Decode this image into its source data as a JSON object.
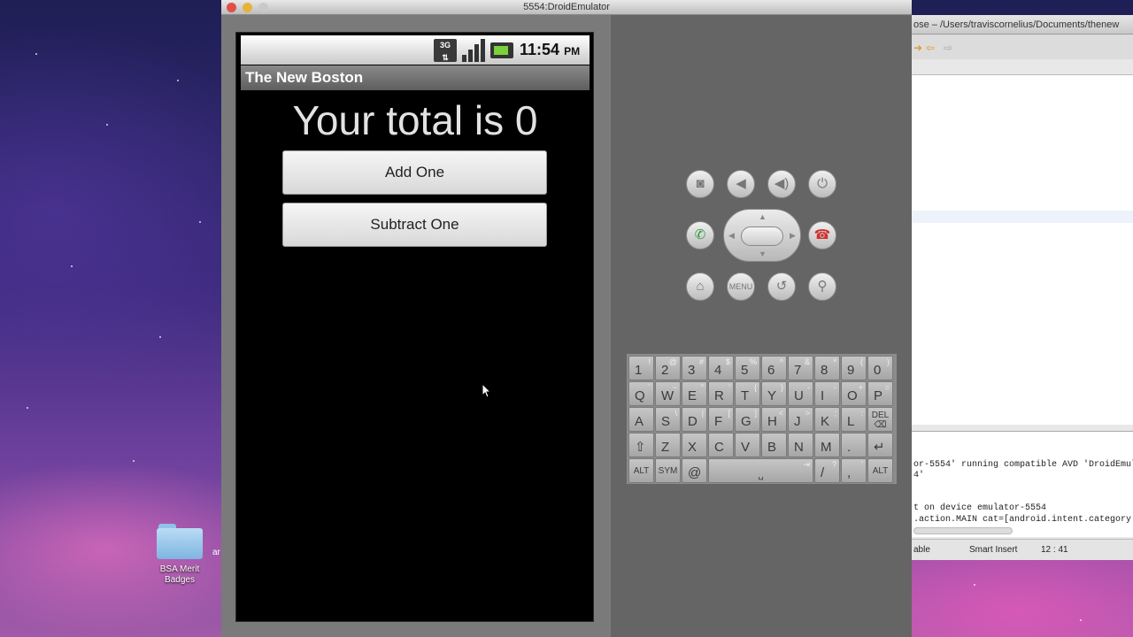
{
  "desktop": {
    "folder_label": "BSA Merit\nBadges",
    "fragment": "ar"
  },
  "eclipse": {
    "title": "ose – /Users/traviscornelius/Documents/thenew",
    "console_lines": [
      "or-5554' running compatible AVD 'DroidEmulat",
      "4'",
      "t on device emulator-5554",
      ".action.MAIN cat=[android.intent.category.LA"
    ],
    "status": {
      "writable": "able",
      "insert_mode": "Smart Insert",
      "position": "12 : 41"
    }
  },
  "emulator": {
    "window_title": "5554:DroidEmulator",
    "statusbar": {
      "network": "3G",
      "time": "11:54",
      "ampm": "PM"
    },
    "app_title": "The New Boston",
    "total_text": "Your total is 0",
    "buttons": {
      "add": "Add One",
      "subtract": "Subtract One"
    },
    "controls": {
      "menu": "MENU"
    },
    "keyboard": {
      "row1": [
        {
          "m": "1",
          "s": "!"
        },
        {
          "m": "2",
          "s": "@"
        },
        {
          "m": "3",
          "s": "#"
        },
        {
          "m": "4",
          "s": "$"
        },
        {
          "m": "5",
          "s": "%"
        },
        {
          "m": "6",
          "s": "^"
        },
        {
          "m": "7",
          "s": "&"
        },
        {
          "m": "8",
          "s": "*"
        },
        {
          "m": "9",
          "s": "("
        },
        {
          "m": "0",
          "s": ")"
        }
      ],
      "row2": [
        {
          "m": "Q",
          "s": "`"
        },
        {
          "m": "W",
          "s": "~"
        },
        {
          "m": "E",
          "s": "\""
        },
        {
          "m": "R",
          "s": "'"
        },
        {
          "m": "T",
          "s": "{"
        },
        {
          "m": "Y",
          "s": "}"
        },
        {
          "m": "U",
          "s": "-"
        },
        {
          "m": "I",
          "s": "-"
        },
        {
          "m": "O",
          "s": "+"
        },
        {
          "m": "P",
          "s": "="
        }
      ],
      "row3": [
        {
          "m": "A",
          "s": ""
        },
        {
          "m": "S",
          "s": "\\"
        },
        {
          "m": "D",
          "s": "|"
        },
        {
          "m": "F",
          "s": "["
        },
        {
          "m": "G",
          "s": "]"
        },
        {
          "m": "H",
          "s": "<"
        },
        {
          "m": "J",
          "s": ">"
        },
        {
          "m": "K",
          "s": ";"
        },
        {
          "m": "L",
          "s": ":"
        },
        {
          "m": "DEL",
          "s": ""
        }
      ],
      "row4": [
        {
          "m": "⇧",
          "s": ""
        },
        {
          "m": "Z",
          "s": ""
        },
        {
          "m": "X",
          "s": ""
        },
        {
          "m": "C",
          "s": ""
        },
        {
          "m": "V",
          "s": ""
        },
        {
          "m": "B",
          "s": ""
        },
        {
          "m": "N",
          "s": ""
        },
        {
          "m": "M",
          "s": ""
        },
        {
          "m": ".",
          "s": ""
        },
        {
          "m": "↵",
          "s": ""
        }
      ],
      "alt": "ALT",
      "sym": "SYM",
      "at": "@",
      "slash": "/",
      "comma": ",",
      "slash_alt": "?",
      "comma_alt": "'"
    }
  }
}
